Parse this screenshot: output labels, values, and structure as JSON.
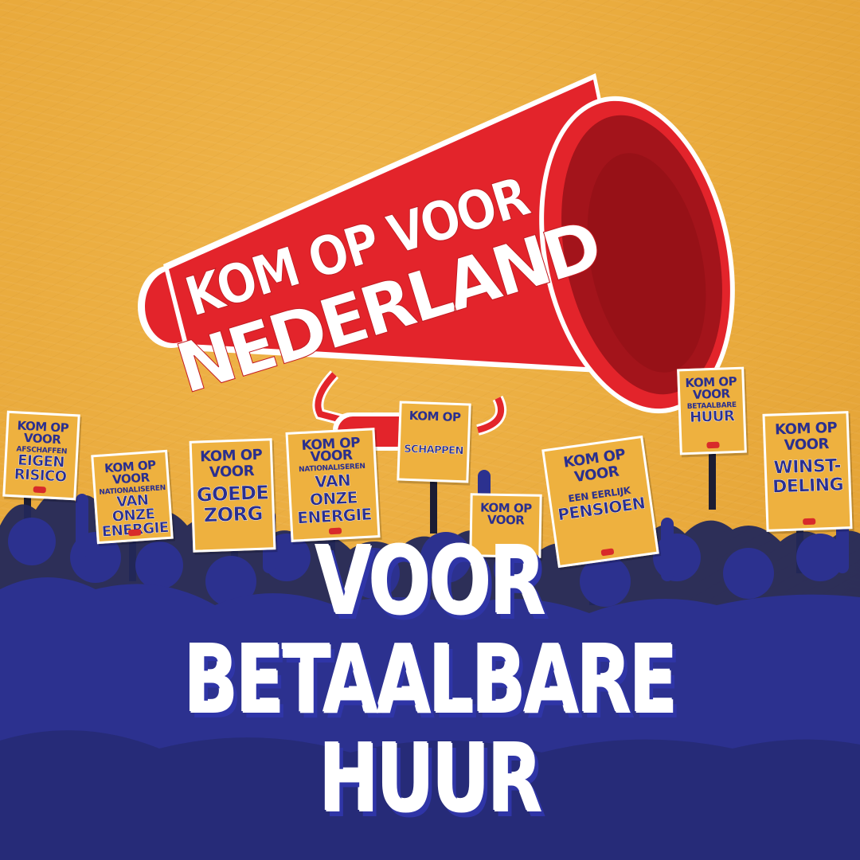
{
  "megaphone": {
    "line1": "KOM OP VOOR",
    "line2": "NEDERLAND",
    "color": "#e3242b"
  },
  "signs": [
    {
      "top": "KOM OP",
      "mid": "VOOR",
      "small": "AFSCHAFFEN",
      "big1": "EIGEN",
      "big2": "RISICO"
    },
    {
      "top": "KOM OP",
      "mid": "VOOR",
      "small": "NATIONALISEREN",
      "big1": "VAN ONZE",
      "big2": "ENERGIE"
    },
    {
      "top": "KOM OP",
      "mid": "VOOR",
      "small": "",
      "big1": "GOEDE",
      "big2": "ZORG"
    },
    {
      "top": "KOM OP",
      "mid": "VOOR",
      "small": "NATIONALISEREN",
      "big1": "VAN ONZE",
      "big2": "ENERGIE"
    },
    {
      "top": "KOM OP",
      "mid": "",
      "small": "",
      "big1": "SCHAPPEN",
      "big2": ""
    },
    {
      "top": "KOM OP",
      "mid": "VOOR",
      "small": "",
      "big1": "",
      "big2": ""
    },
    {
      "top": "KOM OP",
      "mid": "VOOR",
      "small": "EEN EERLIJK",
      "big1": "PENSIOEN",
      "big2": ""
    },
    {
      "top": "KOM OP",
      "mid": "VOOR",
      "small": "BETAALBARE",
      "big1": "HUUR",
      "big2": ""
    },
    {
      "top": "KOM OP",
      "mid": "VOOR",
      "small": "",
      "big1": "WINST-",
      "big2": "DELING"
    }
  ],
  "headline": {
    "line1": "VOOR",
    "line2": "BETAALBARE HUUR"
  },
  "colors": {
    "background": "#e9aa3c",
    "crowd": "#2c318f",
    "crowd_dark": "#23285a",
    "sign": "#eeb13f",
    "sign_text": "#2a2f8f"
  }
}
